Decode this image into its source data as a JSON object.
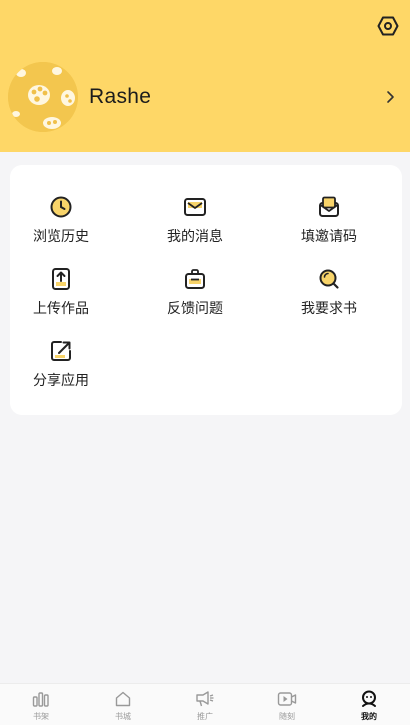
{
  "profile": {
    "username": "Rashe"
  },
  "menu": [
    {
      "label": "浏览历史",
      "icon": "clock-icon"
    },
    {
      "label": "我的消息",
      "icon": "envelope-icon"
    },
    {
      "label": "填邀请码",
      "icon": "invite-envelope-icon"
    },
    {
      "label": "上传作品",
      "icon": "upload-icon"
    },
    {
      "label": "反馈问题",
      "icon": "feedback-bag-icon"
    },
    {
      "label": "我要求书",
      "icon": "search-book-icon"
    },
    {
      "label": "分享应用",
      "icon": "share-icon"
    }
  ],
  "tabbar": [
    {
      "label": "书架",
      "icon": "bookshelf-icon"
    },
    {
      "label": "书城",
      "icon": "home-icon"
    },
    {
      "label": "推广",
      "icon": "megaphone-icon"
    },
    {
      "label": "随刻",
      "icon": "video-icon"
    },
    {
      "label": "我的",
      "icon": "profile-icon",
      "active": true
    }
  ],
  "colors": {
    "header_bg": "#fed767",
    "accent": "#f3b52a",
    "icon_stroke": "#222222",
    "page_bg": "#f5f5f7"
  }
}
